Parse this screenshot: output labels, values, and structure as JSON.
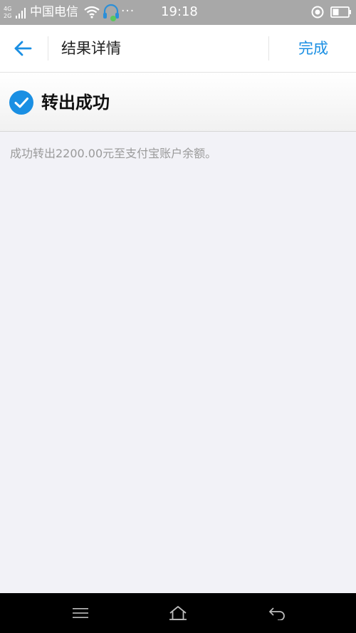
{
  "status_bar": {
    "network_top": "4G",
    "network_bottom": "2G",
    "carrier": "中国电信",
    "more_dots": "···",
    "time": "19:18",
    "icons": [
      "signal-icon",
      "wifi-icon",
      "headset-icon",
      "location-icon",
      "battery-icon"
    ]
  },
  "header": {
    "back_icon": "arrow-left-icon",
    "title": "结果详情",
    "done_label": "完成"
  },
  "result": {
    "status_icon": "check-circle-icon",
    "title": "转出成功",
    "message": "成功转出2200.00元至支付宝账户余额。"
  },
  "nav_bar": {
    "icons": [
      "menu-icon",
      "home-icon",
      "back-icon"
    ]
  },
  "colors": {
    "accent": "#1a8fe3",
    "status_bar_bg": "#a8a8a8",
    "page_bg": "#f2f2f7",
    "nav_bar_bg": "#000000",
    "message_text": "#9a9a9a"
  }
}
